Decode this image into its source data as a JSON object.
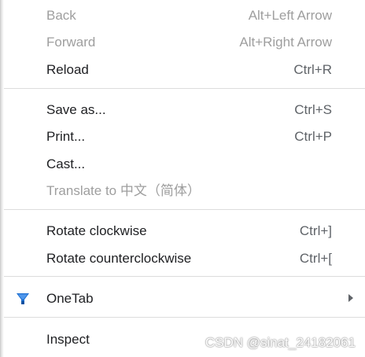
{
  "menu": {
    "back": {
      "label": "Back",
      "shortcut": "Alt+Left Arrow"
    },
    "forward": {
      "label": "Forward",
      "shortcut": "Alt+Right Arrow"
    },
    "reload": {
      "label": "Reload",
      "shortcut": "Ctrl+R"
    },
    "save_as": {
      "label": "Save as...",
      "shortcut": "Ctrl+S"
    },
    "print": {
      "label": "Print...",
      "shortcut": "Ctrl+P"
    },
    "cast": {
      "label": "Cast..."
    },
    "translate": {
      "label": "Translate to 中文（简体）"
    },
    "rotate_cw": {
      "label": "Rotate clockwise",
      "shortcut": "Ctrl+]"
    },
    "rotate_ccw": {
      "label": "Rotate counterclockwise",
      "shortcut": "Ctrl+["
    },
    "onetab": {
      "label": "OneTab",
      "icon": "onetab-funnel-icon"
    },
    "inspect": {
      "label": "Inspect"
    }
  },
  "watermark": "CSDN @sinat_24182061",
  "colors": {
    "text": "#202124",
    "disabled_text": "#9e9e9e",
    "shortcut_text": "#5f6368",
    "separator": "#dcdcdc",
    "onetab_icon": "#1e6fd0"
  }
}
